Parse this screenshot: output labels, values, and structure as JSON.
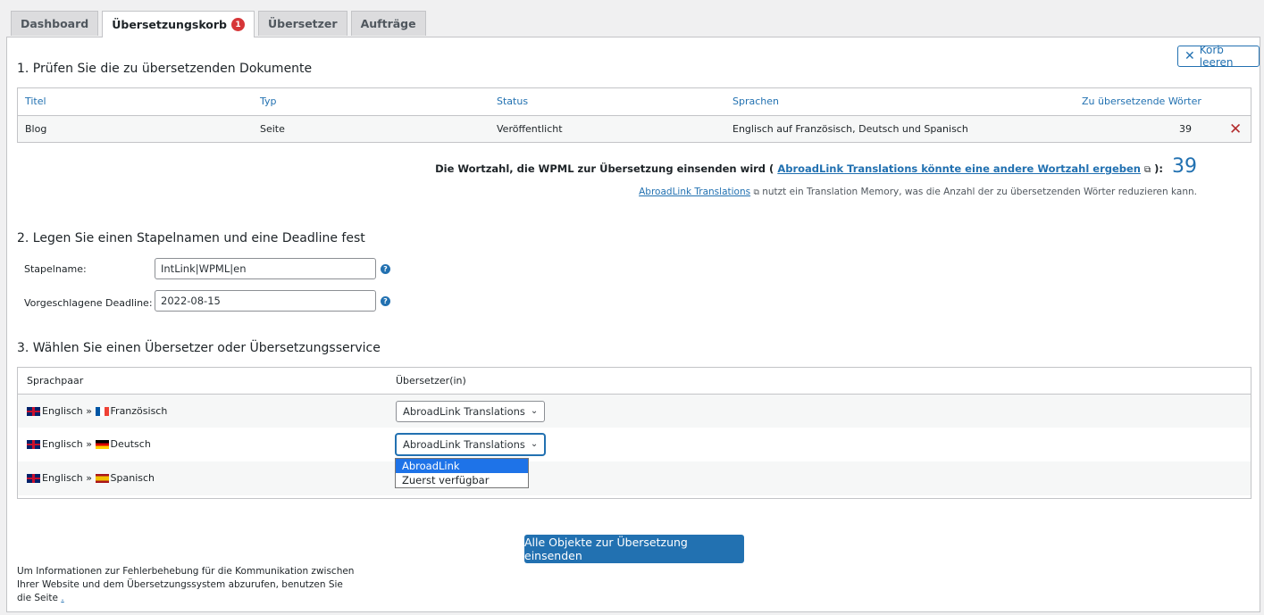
{
  "tabs": [
    {
      "label": "Dashboard"
    },
    {
      "label": "Übersetzungskorb",
      "badge": "1"
    },
    {
      "label": "Übersetzer"
    },
    {
      "label": "Aufträge"
    }
  ],
  "clear_basket": "Korb leeren",
  "section1": {
    "title": "1. Prüfen Sie die zu übersetzenden Dokumente",
    "headers": {
      "title": "Titel",
      "type": "Typ",
      "status": "Status",
      "languages": "Sprachen",
      "words": "Zu übersetzende Wörter"
    },
    "row": {
      "title": "Blog",
      "type": "Seite",
      "status": "Veröffentlicht",
      "languages": "Englisch auf Französisch, Deutsch und Spanisch",
      "words": "39"
    }
  },
  "wordcount": {
    "prefix": "Die Wortzahl, die WPML zur Übersetzung einsenden wird (",
    "link": "AbroadLink Translations könnte eine andere Wortzahl ergeben",
    "suffix": "):",
    "value": "39"
  },
  "tm_note": {
    "link": "AbroadLink Translations",
    "text": " nutzt ein Translation Memory, was die Anzahl der zu übersetzenden Wörter reduzieren kann."
  },
  "section2": {
    "title": "2. Legen Sie einen Stapelnamen und eine Deadline fest",
    "batch_label": "Stapelname:",
    "batch_value": "IntLink|WPML|en",
    "deadline_label": "Vorgeschlagene Deadline:",
    "deadline_value": "2022-08-15"
  },
  "section3": {
    "title": "3. Wählen Sie einen Übersetzer oder Übersetzungsservice",
    "headers": {
      "pair": "Sprachpaar",
      "translator": "Übersetzer(in)"
    },
    "rows": [
      {
        "from": "Englisch",
        "sep": " » ",
        "to": "Französisch",
        "selected": "AbroadLink Translations"
      },
      {
        "from": "Englisch",
        "sep": " » ",
        "to": "Deutsch",
        "selected": "AbroadLink Translations"
      },
      {
        "from": "Englisch",
        "sep": " » ",
        "to": "Spanisch"
      }
    ],
    "dropdown_options": [
      "AbroadLink Translations",
      "Zuerst verfügbar"
    ]
  },
  "submit_label": "Alle Objekte zur Übersetzung einsenden",
  "footer": {
    "text": "Um Informationen zur Fehlerbehebung für die Kommunikation zwischen Ihrer Website und dem Übersetzungssystem abzurufen, benutzen Sie die Seite ",
    "link": "."
  }
}
